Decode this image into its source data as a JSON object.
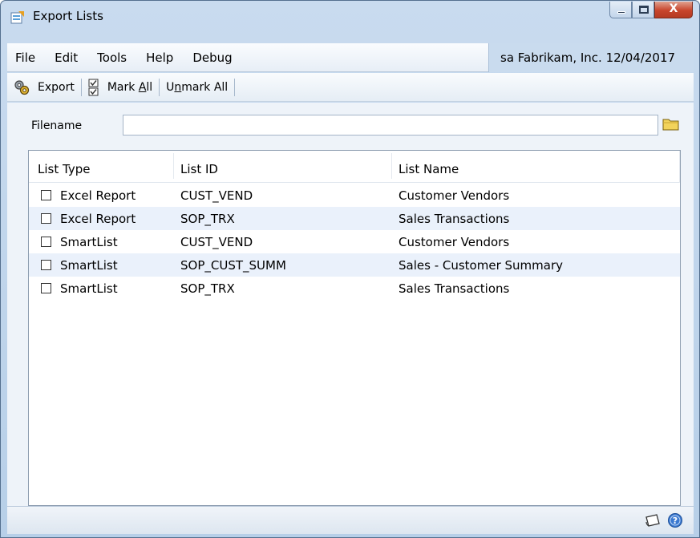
{
  "window": {
    "title": "Export Lists",
    "close_glyph": "X"
  },
  "menu": {
    "items": [
      "File",
      "Edit",
      "Tools",
      "Help",
      "Debug"
    ]
  },
  "status": {
    "user": "sa",
    "company": "Fabrikam, Inc.",
    "date": "12/04/2017"
  },
  "toolbar": {
    "export_label": "Export",
    "mark_all_prefix": "Mark ",
    "mark_all_underlined": "A",
    "mark_all_suffix": "ll",
    "unmark_all_prefix": "U",
    "unmark_all_underlined": "n",
    "unmark_all_suffix": "mark All"
  },
  "filename": {
    "label": "Filename",
    "value": ""
  },
  "list": {
    "columns": [
      "List Type",
      "List ID",
      "List Name"
    ],
    "rows": [
      {
        "type": "Excel Report",
        "id": "CUST_VEND",
        "name": "Customer Vendors",
        "checked": false
      },
      {
        "type": "Excel Report",
        "id": "SOP_TRX",
        "name": "Sales Transactions",
        "checked": false
      },
      {
        "type": "SmartList",
        "id": "CUST_VEND",
        "name": "Customer Vendors",
        "checked": false
      },
      {
        "type": "SmartList",
        "id": "SOP_CUST_SUMM",
        "name": "Sales - Customer Summary",
        "checked": false
      },
      {
        "type": "SmartList",
        "id": "SOP_TRX",
        "name": "Sales Transactions",
        "checked": false
      }
    ]
  },
  "icons": {
    "app": "export-lists-icon",
    "export": "gear-icon",
    "mark_all": "checkbox-pair-icon",
    "folder": "folder-icon",
    "note": "note-icon",
    "help": "help-icon"
  },
  "colors": {
    "window_frame": "#b7cfe8",
    "status_box": "#c9dbee",
    "alt_row": "#eaf1fb",
    "close_button": "#c8452c"
  }
}
